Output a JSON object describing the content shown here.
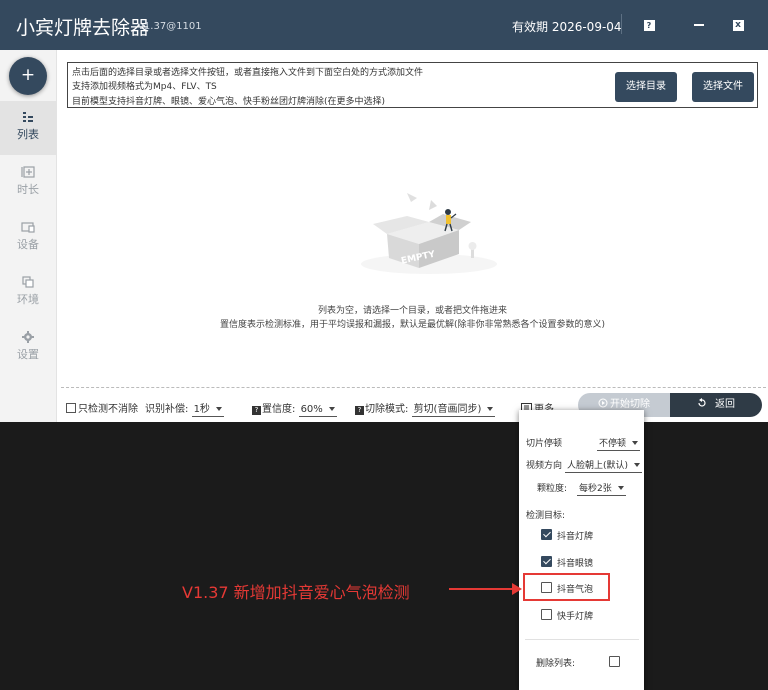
{
  "titlebar": {
    "title": "小宾灯牌去除器",
    "version": "v1.37@1101",
    "expiry": "有效期 2026-09-04",
    "help_glyph": "?",
    "close_glyph": "x"
  },
  "sidebar": {
    "add_glyph": "+",
    "items": [
      {
        "label": "列表",
        "icon": "list-icon"
      },
      {
        "label": "时长",
        "icon": "duration-icon"
      },
      {
        "label": "设备",
        "icon": "device-icon"
      },
      {
        "label": "环境",
        "icon": "environment-icon"
      },
      {
        "label": "设置",
        "icon": "gear-icon"
      }
    ]
  },
  "info": {
    "line1": "点击后面的选择目录或者选择文件按钮，或者直接拖入文件到下面空白处的方式添加文件",
    "line2": "支持添加视频格式为Mp4、FLV、TS",
    "line3": "目前模型支持抖音灯牌、眼镜、爱心气泡、快手粉丝团灯牌消除(在更多中选择)",
    "select_dir": "选择目录",
    "select_file": "选择文件"
  },
  "empty": {
    "badge": "EMPTY",
    "text1": "列表为空，请选择一个目录，或者把文件拖进来",
    "text2": "置信度表示检测标准，用于平均误报和漏报，默认是最优解(除非你非常熟悉各个设置参数的意义)"
  },
  "bottom": {
    "detect_only": "只检测不消除",
    "recog_label": "识别补偿:",
    "recog_value": "1秒",
    "conf_label": "置信度:",
    "conf_value": "60%",
    "mode_label": "切除模式:",
    "mode_value": "剪切(音画同步)",
    "more": "更多",
    "start": "开始切除",
    "back": "返回"
  },
  "popup": {
    "slice_label": "切片停顿",
    "slice_value": "不停顿",
    "dir_label": "视频方向",
    "dir_value": "人脸朝上(默认)",
    "gran_label": "颗粒度:",
    "gran_value": "每秒2张",
    "targets_label": "检测目标:",
    "targets": [
      {
        "label": "抖音灯牌",
        "checked": true
      },
      {
        "label": "抖音眼镜",
        "checked": true
      },
      {
        "label": "抖音气泡",
        "checked": false
      },
      {
        "label": "快手灯牌",
        "checked": false
      }
    ],
    "delete_label": "删除列表:"
  },
  "annotation": {
    "text": "V1.37 新增加抖音爱心气泡检测",
    "color": "#e53935"
  },
  "colors": {
    "brand": "#34495e",
    "accent_yellow": "#f2c12e"
  }
}
